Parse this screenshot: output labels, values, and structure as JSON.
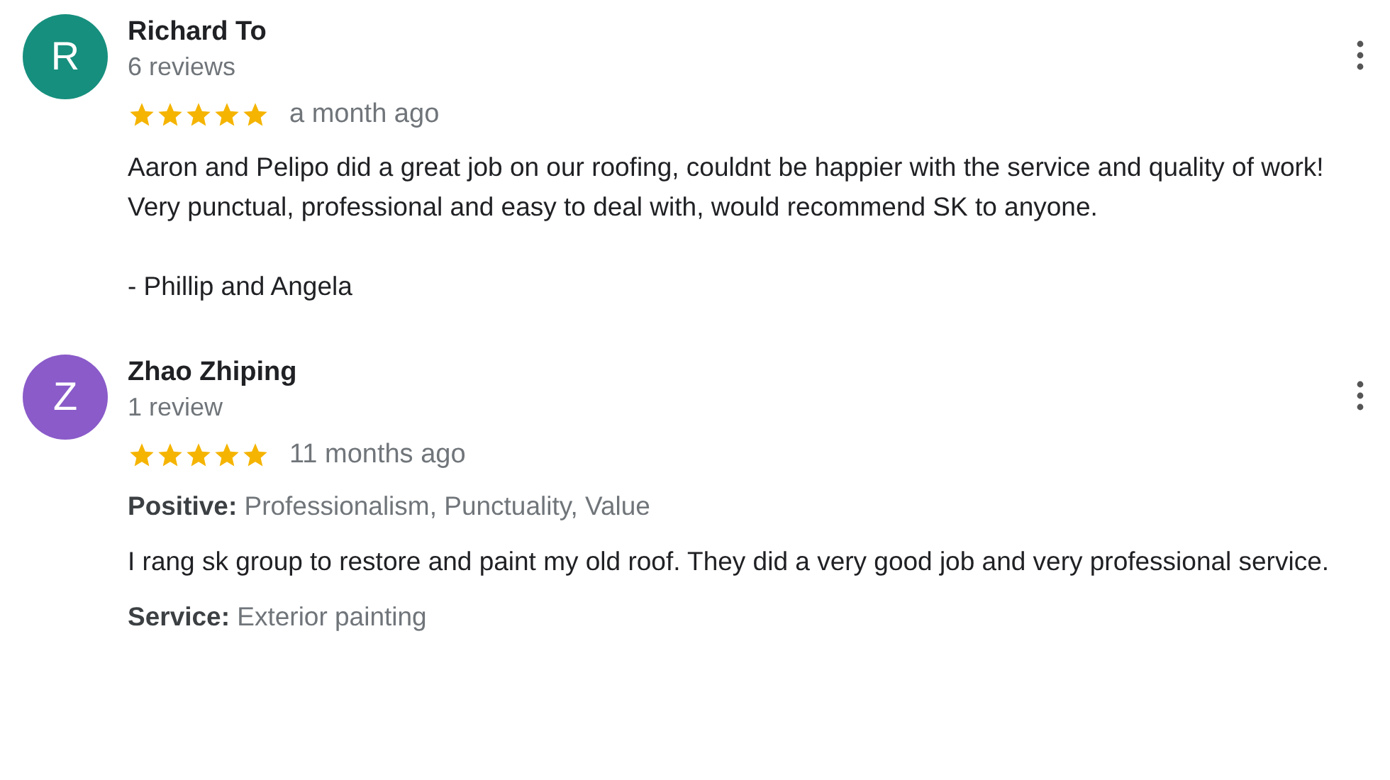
{
  "reviews": [
    {
      "avatar_letter": "R",
      "color": "#168f7e",
      "name": "Richard To",
      "review_count": "6 reviews",
      "stars": 5,
      "time": "a month ago",
      "blocks": [
        {
          "kind": "text",
          "text": "Aaron and Pelipo did a great job on our roofing, couldnt be happier with the service and quality of work! Very punctual, professional and easy to deal with, would recommend SK to anyone."
        },
        {
          "kind": "text",
          "text": "- Phillip and Angela"
        }
      ]
    },
    {
      "avatar_letter": "Z",
      "color": "#8a5bc9",
      "name": "Zhao Zhiping",
      "review_count": "1 review",
      "stars": 5,
      "time": "11 months ago",
      "blocks": [
        {
          "kind": "attribute",
          "label": "Positive:",
          "value": "Professionalism, Punctuality, Value"
        },
        {
          "kind": "text",
          "text": "I rang sk group to restore and paint my old roof. They did a very good job and very professional service."
        },
        {
          "kind": "attribute",
          "label": "Service:",
          "value": "Exterior painting"
        }
      ]
    }
  ]
}
